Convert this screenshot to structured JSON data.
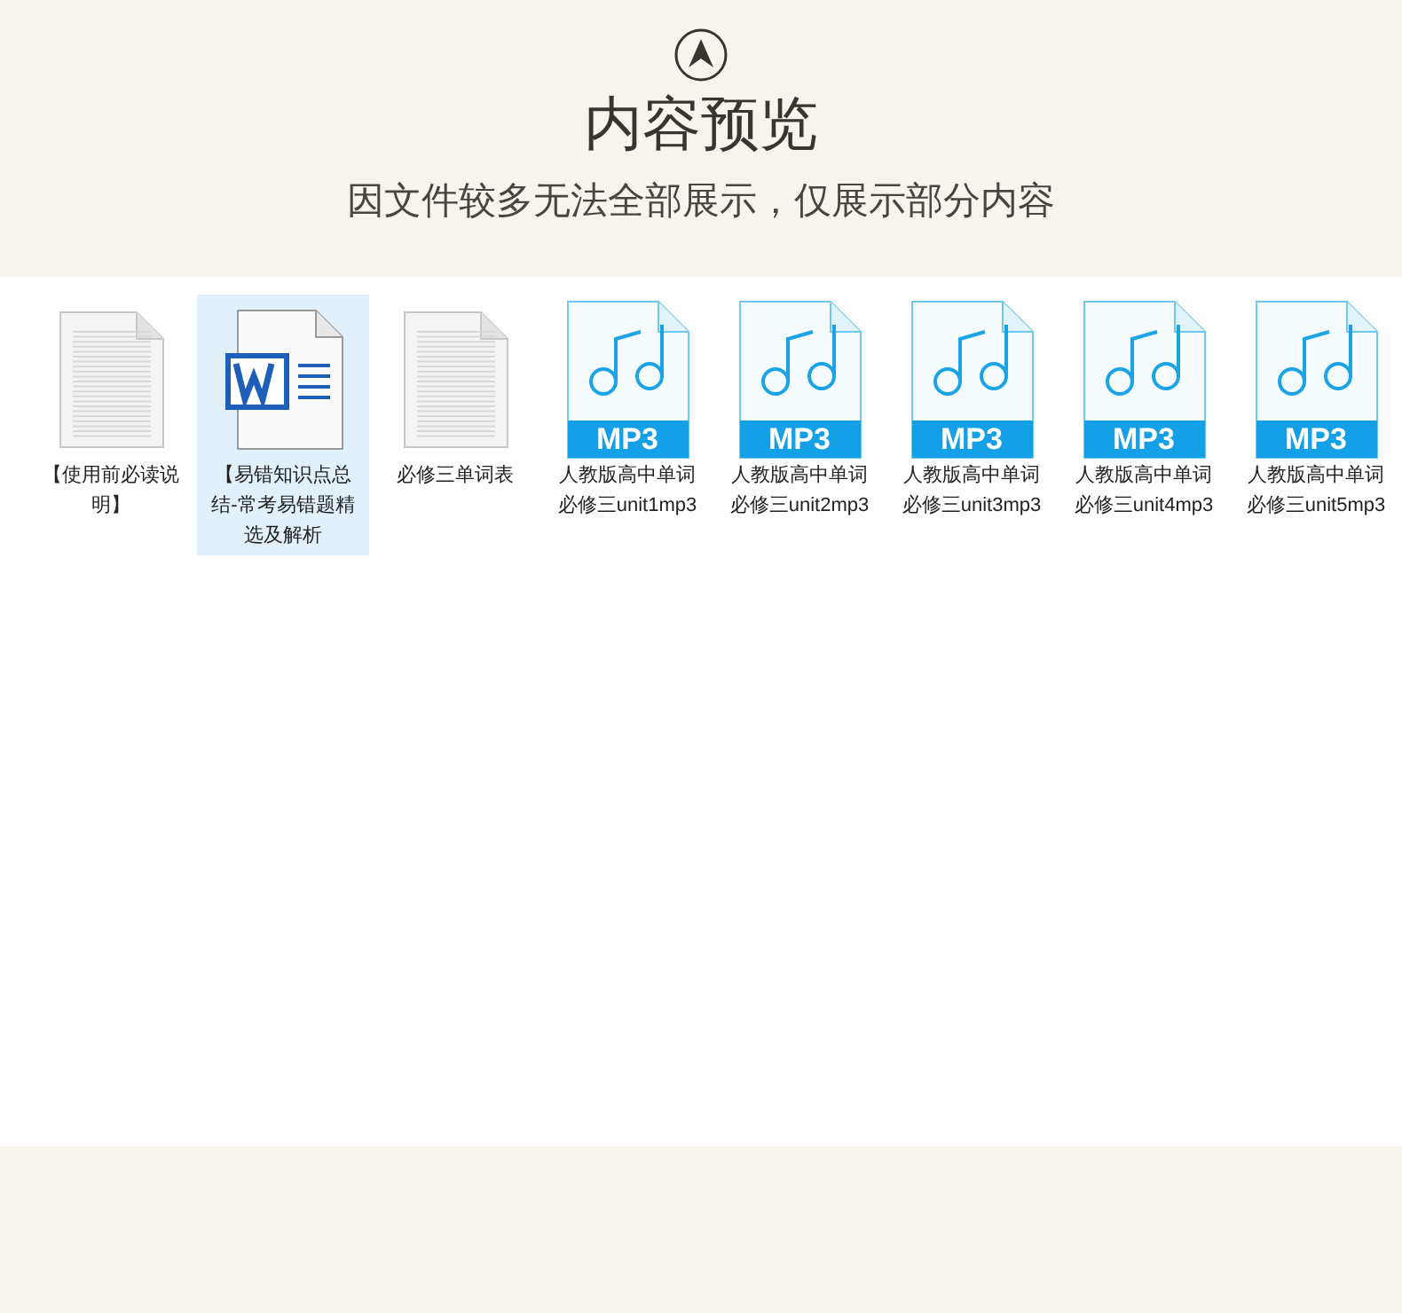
{
  "header": {
    "title": "内容预览",
    "subtitle": "因文件较多无法全部展示，仅展示部分内容"
  },
  "files": [
    {
      "kind": "doc",
      "name": "【使用前必读说明】",
      "selected": false
    },
    {
      "kind": "word",
      "name": "【易错知识点总结-常考易错题精选及解析",
      "selected": true
    },
    {
      "kind": "doc",
      "name": "必修三单词表",
      "selected": false
    },
    {
      "kind": "mp3",
      "name": "人教版高中单词必修三unit1mp3",
      "badge": "MP3",
      "selected": false
    },
    {
      "kind": "mp3",
      "name": "人教版高中单词必修三unit2mp3",
      "badge": "MP3",
      "selected": false
    },
    {
      "kind": "mp3",
      "name": "人教版高中单词必修三unit3mp3",
      "badge": "MP3",
      "selected": false
    },
    {
      "kind": "mp3",
      "name": "人教版高中单词必修三unit4mp3",
      "badge": "MP3",
      "selected": false
    },
    {
      "kind": "mp3",
      "name": "人教版高中单词必修三unit5mp3",
      "badge": "MP3",
      "selected": false
    }
  ]
}
